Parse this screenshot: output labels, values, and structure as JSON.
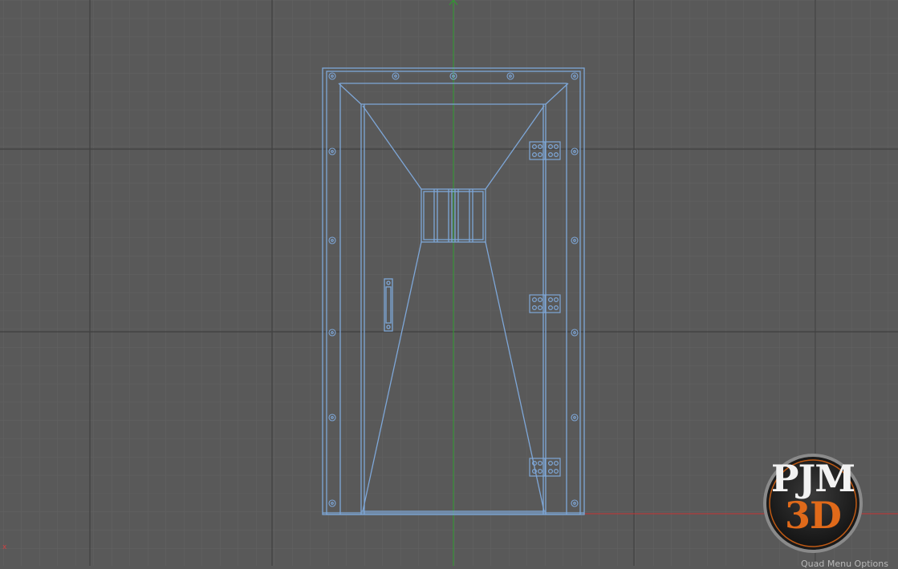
{
  "viewport": {
    "view_name": "front-orthographic",
    "colors": {
      "background": "#595959",
      "grid_minor": "#626262",
      "grid_major": "#444444",
      "wireframe": "#7ea7d8",
      "y_axis": "#2ea02e",
      "x_axis": "#c83232"
    },
    "axis_x_label": "x",
    "status_text": "Quad Menu Options"
  },
  "logo": {
    "line1": "PJM",
    "line2": "3D",
    "ring_color": "#8a8a8a",
    "accent_color": "#e06a1a"
  }
}
